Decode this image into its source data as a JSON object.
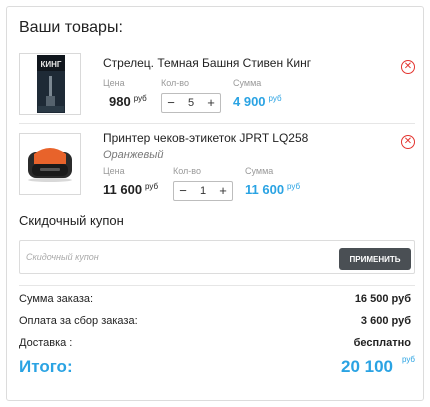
{
  "cart": {
    "title": "Ваши товары:",
    "labels": {
      "price": "Цена",
      "qty": "Кол-во",
      "sum": "Сумма"
    },
    "items": [
      {
        "name": "Стрелец. Темная Башня Стивен Кинг",
        "variant": "",
        "price": "980",
        "qty": "5",
        "sum": "4 900",
        "currency": "руб",
        "cover_text": "КИНГ"
      },
      {
        "name": "Принтер чеков-этикеток JPRT LQ258",
        "variant": "Оранжевый",
        "price": "11 600",
        "qty": "1",
        "sum": "11 600",
        "currency": "руб"
      }
    ]
  },
  "coupon": {
    "title": "Скидочный купон",
    "placeholder": "Скидочный купон",
    "button": "ПРИМЕНИТЬ"
  },
  "summary": {
    "rows": [
      {
        "label": "Сумма заказа:",
        "value": "16 500 руб"
      },
      {
        "label": "Оплата за сбор заказа:",
        "value": "3 600 руб"
      },
      {
        "label": "Доставка :",
        "value": "бесплатно"
      }
    ],
    "total_label": "Итого:",
    "total_value": "20 100",
    "total_currency": "руб"
  },
  "icons": {
    "stepper_minus": "−",
    "stepper_plus": "+",
    "remove": "✕"
  },
  "colors": {
    "accent": "#2aa3e3",
    "danger": "#e3342f",
    "button": "#4a4f54",
    "printer_orange": "#e8632b"
  }
}
